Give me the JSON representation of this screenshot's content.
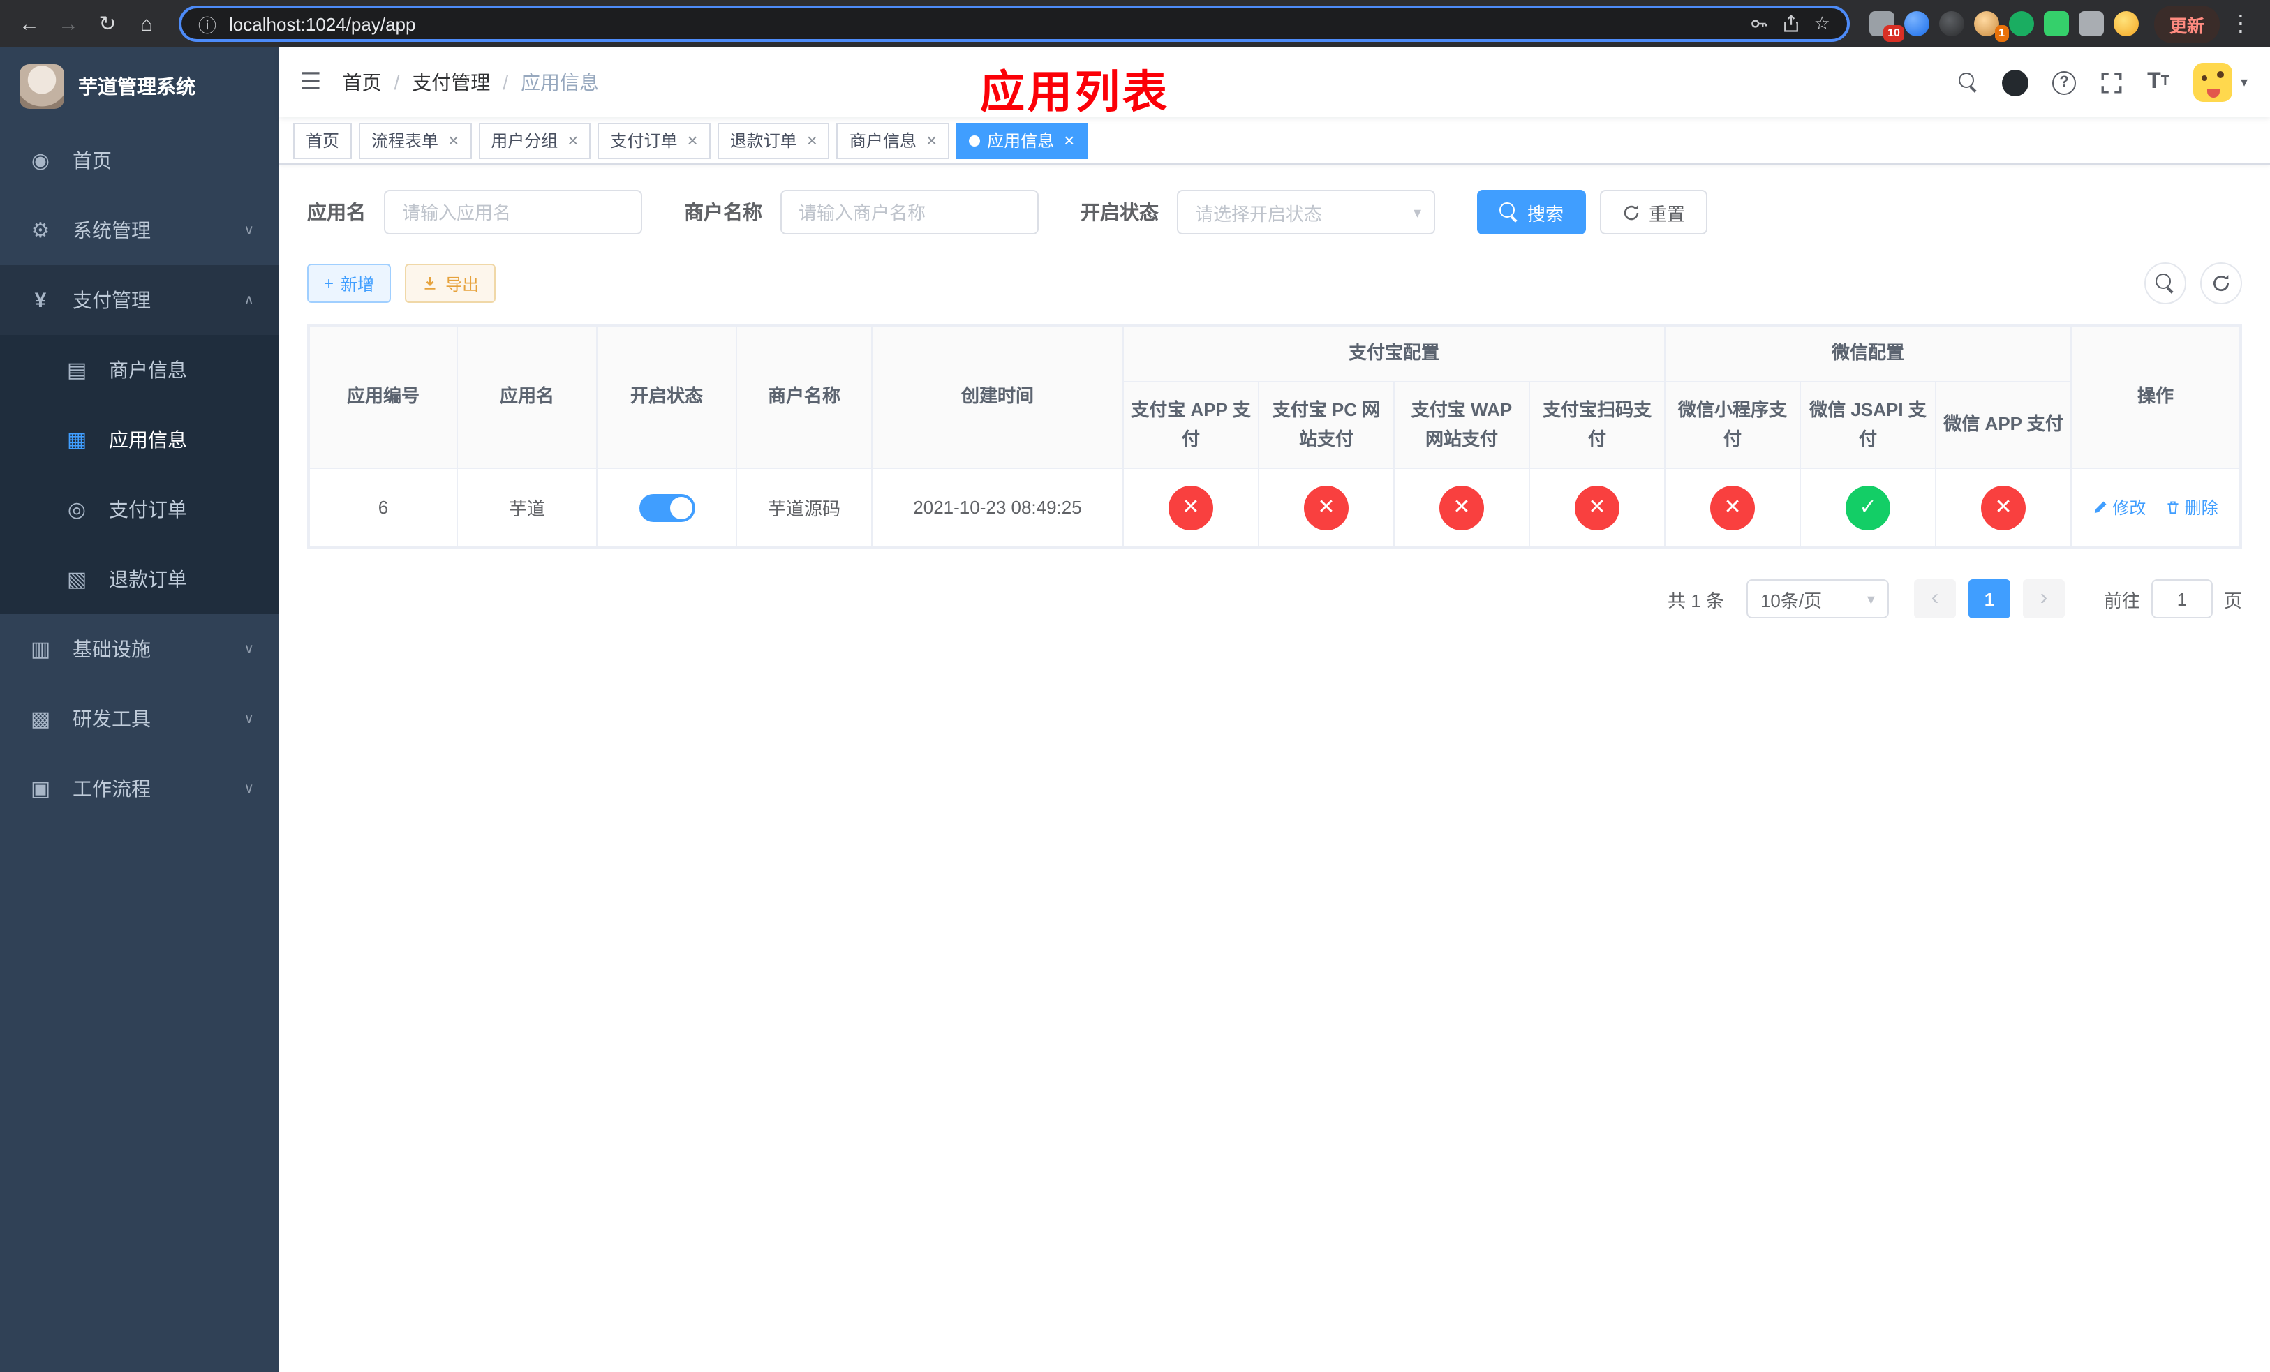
{
  "browser": {
    "url": "localhost:1024/pay/app",
    "update_label": "更新",
    "ext_badge_puzzle": "10",
    "ext_badge_avatar": "1"
  },
  "icons": {
    "back": "←",
    "forward": "→",
    "reload": "↻",
    "home_button": "⌂",
    "info": "ⓘ",
    "star": "☆",
    "more": "⋮",
    "hamburger": "☰",
    "separator": "/",
    "close": "×",
    "caret_down": "▾",
    "chevron_collapsed": "∨",
    "chevron_expanded": "∧",
    "check": "✓",
    "cross": "✕",
    "plus": "+",
    "question": "?",
    "prev": "‹",
    "next": "›",
    "home": "◉",
    "system": "⚙",
    "payment": "¥",
    "merchant": "▤",
    "app": "▦",
    "pay_order": "◎",
    "refund_order": "▧",
    "infra": "▥",
    "devtools": "▩",
    "workflow": "▣",
    "tsize_big": "T",
    "tsize_small": "T"
  },
  "sidebar": {
    "app_title": "芋道管理系统",
    "items": [
      {
        "label": "首页"
      },
      {
        "label": "系统管理"
      },
      {
        "label": "支付管理"
      },
      {
        "label": "基础设施"
      },
      {
        "label": "研发工具"
      },
      {
        "label": "工作流程"
      }
    ],
    "pay_children": [
      {
        "label": "商户信息"
      },
      {
        "label": "应用信息"
      },
      {
        "label": "支付订单"
      },
      {
        "label": "退款订单"
      }
    ]
  },
  "header": {
    "breadcrumb": [
      {
        "label": "首页"
      },
      {
        "label": "支付管理"
      },
      {
        "label": "应用信息"
      }
    ],
    "annotation": "应用列表"
  },
  "tabs": [
    {
      "label": "首页"
    },
    {
      "label": "流程表单"
    },
    {
      "label": "用户分组"
    },
    {
      "label": "支付订单"
    },
    {
      "label": "退款订单"
    },
    {
      "label": "商户信息"
    },
    {
      "label": "应用信息"
    }
  ],
  "filters": {
    "app_name_label": "应用名",
    "app_name_placeholder": "请输入应用名",
    "merchant_label": "商户名称",
    "merchant_placeholder": "请输入商户名称",
    "status_label": "开启状态",
    "status_placeholder": "请选择开启状态",
    "search_label": "搜索",
    "reset_label": "重置"
  },
  "toolbar": {
    "add_label": "新增",
    "export_label": "导出"
  },
  "table": {
    "main_columns": [
      "应用编号",
      "应用名",
      "开启状态",
      "商户名称",
      "创建时间"
    ],
    "alipay_group": "支付宝配置",
    "wechat_group": "微信配置",
    "alipay_columns": [
      "支付宝 APP 支付",
      "支付宝 PC 网站支付",
      "支付宝 WAP 网站支付",
      "支付宝扫码支付"
    ],
    "wechat_columns": [
      "微信小程序支付",
      "微信 JSAPI 支付",
      "微信 APP 支付"
    ],
    "actions_column": "操作",
    "status_colors": {
      "on": "#13ce66",
      "off": "#f9403f"
    },
    "rows": [
      {
        "id": "6",
        "name": "芋道",
        "enabled": true,
        "merchant": "芋道源码",
        "created_at": "2021-10-23 08:49:25",
        "configs": [
          false,
          false,
          false,
          false,
          false,
          true,
          false
        ],
        "edit_label": "修改",
        "delete_label": "删除"
      }
    ]
  },
  "pagination": {
    "total_text": "共 1 条",
    "page_size": "10条/页",
    "page": "1",
    "goto_prefix": "前往",
    "goto_value": "1",
    "goto_suffix": "页"
  }
}
